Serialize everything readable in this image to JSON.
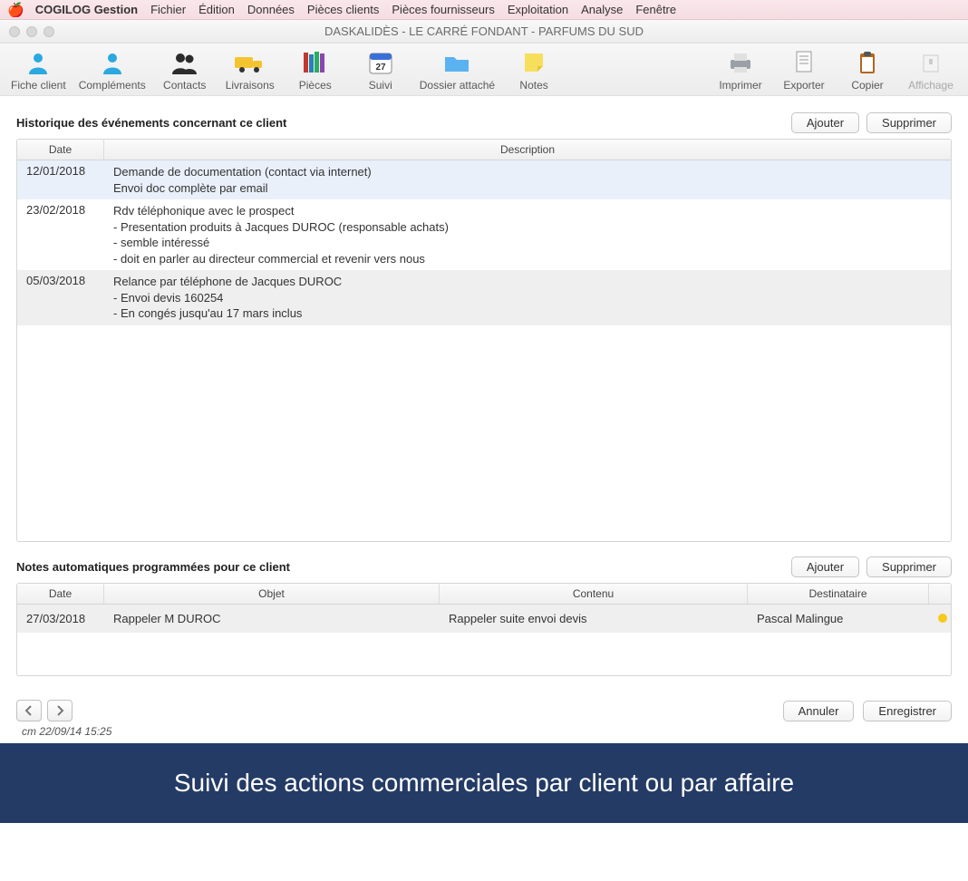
{
  "menubar": {
    "app": "COGILOG Gestion",
    "items": [
      "Fichier",
      "Édition",
      "Données",
      "Pièces clients",
      "Pièces fournisseurs",
      "Exploitation",
      "Analyse",
      "Fenêtre"
    ]
  },
  "window_title": "DASKALIDÈS - LE CARRÉ FONDANT - PARFUMS DU SUD",
  "toolbar_left": [
    {
      "label": "Fiche client"
    },
    {
      "label": "Compléments"
    },
    {
      "label": "Contacts"
    },
    {
      "label": "Livraisons"
    },
    {
      "label": "Pièces"
    },
    {
      "label": "Suivi"
    },
    {
      "label": "Dossier attaché"
    },
    {
      "label": "Notes"
    }
  ],
  "toolbar_right": [
    {
      "label": "Imprimer"
    },
    {
      "label": "Exporter"
    },
    {
      "label": "Copier"
    },
    {
      "label": "Affichage"
    }
  ],
  "history": {
    "title": "Historique des événements concernant ce client",
    "buttons": {
      "add": "Ajouter",
      "remove": "Supprimer"
    },
    "columns": [
      "Date",
      "Description"
    ],
    "rows": [
      {
        "date": "12/01/2018",
        "desc": "Demande de documentation (contact via internet)\nEnvoi doc complète par email"
      },
      {
        "date": "23/02/2018",
        "desc": "Rdv téléphonique avec le prospect\n- Presentation produits à Jacques DUROC (responsable achats)\n- semble intéressé\n- doit en parler au directeur commercial et revenir vers nous"
      },
      {
        "date": "05/03/2018",
        "desc": "Relance par téléphone de Jacques DUROC\n- Envoi devis 160254\n- En congés jusqu'au 17 mars inclus"
      }
    ]
  },
  "notes": {
    "title": "Notes automatiques programmées pour ce client",
    "buttons": {
      "add": "Ajouter",
      "remove": "Supprimer"
    },
    "columns": [
      "Date",
      "Objet",
      "Contenu",
      "Destinataire"
    ],
    "rows": [
      {
        "date": "27/03/2018",
        "objet": "Rappeler M DUROC",
        "contenu": "Rappeler suite envoi devis",
        "dest": "Pascal Malingue"
      }
    ]
  },
  "footer_buttons": {
    "cancel": "Annuler",
    "save": "Enregistrer"
  },
  "timestamp": "cm 22/09/14 15:25",
  "banner": "Suivi des actions commerciales par client ou par affaire"
}
